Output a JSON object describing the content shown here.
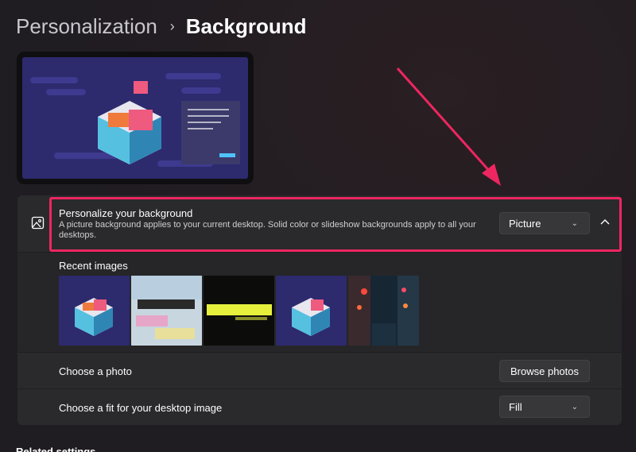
{
  "breadcrumb": {
    "parent": "Personalization",
    "separator": "›",
    "current": "Background"
  },
  "background_section": {
    "title": "Personalize your background",
    "description": "A picture background applies to your current desktop. Solid color or slideshow backgrounds apply to all your desktops.",
    "type_dropdown": {
      "selected": "Picture"
    }
  },
  "recent": {
    "label": "Recent images",
    "images": [
      "keycap-sushi",
      "qk75-tape-mod",
      "cyberpunk-edgerunners",
      "keycap-sushi-2",
      "neon-street"
    ]
  },
  "choose_photo": {
    "label": "Choose a photo",
    "button": "Browse photos"
  },
  "fit": {
    "label": "Choose a fit for your desktop image",
    "selected": "Fill"
  },
  "next_heading": "Related settings",
  "colors": {
    "highlight": "#ee2661",
    "card": "#2a2a2c",
    "dropdown": "#373739"
  }
}
